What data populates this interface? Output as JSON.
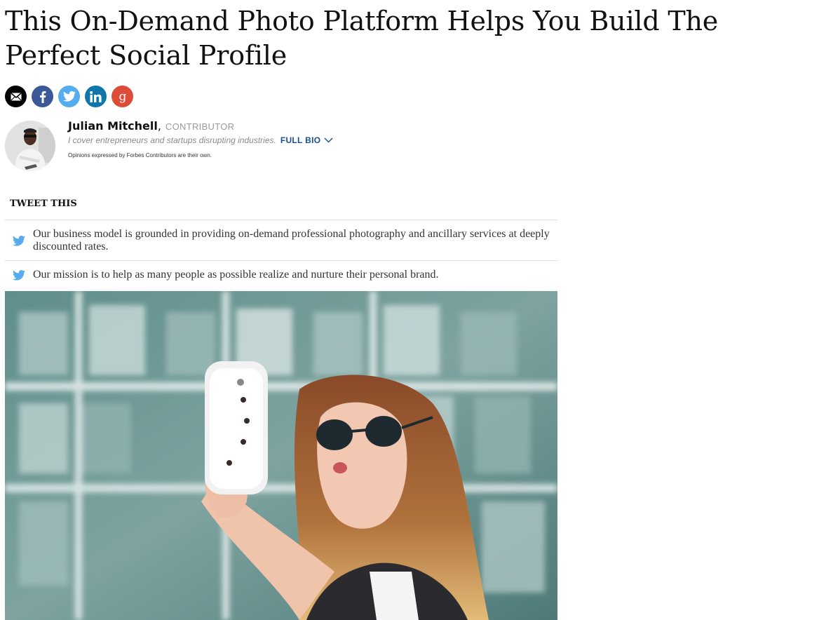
{
  "article": {
    "headline": "This On-Demand Photo Platform Helps You Build The Perfect Social Profile"
  },
  "share": [
    {
      "network": "email",
      "icon": "envelope-icon",
      "color": "#000000"
    },
    {
      "network": "facebook",
      "icon": "facebook-icon",
      "color": "#3b5998"
    },
    {
      "network": "twitter",
      "icon": "twitter-icon",
      "color": "#55acee"
    },
    {
      "network": "linkedin",
      "icon": "linkedin-icon",
      "color": "#0e76a8"
    },
    {
      "network": "google-plus",
      "icon": "google-plus-icon",
      "color": "#dd4b39"
    }
  ],
  "author": {
    "name": "Julian Mitchell",
    "separator": ",",
    "role": "CONTRIBUTOR",
    "bio": "I cover entrepreneurs and startups disrupting industries.",
    "full_bio_label": "FULL BIO",
    "disclaimer": "Opinions expressed by Forbes Contributors are their own."
  },
  "tweet_this": {
    "heading": "TWEET THIS",
    "items": [
      "Our business model is grounded in providing on-demand professional photography and ancillary services at deeply discounted rates.",
      "Our mission is to help as many people as possible realize and nurture their personal brand."
    ]
  },
  "colors": {
    "link": "#1a4f8b",
    "twitter": "#55acee",
    "muted": "#999999"
  }
}
